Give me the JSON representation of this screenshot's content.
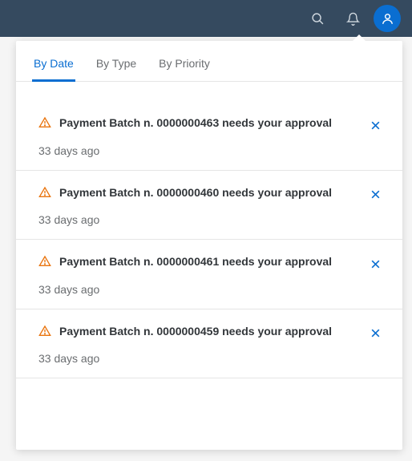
{
  "tabs": [
    {
      "label": "By Date",
      "active": true
    },
    {
      "label": "By Type",
      "active": false
    },
    {
      "label": "By Priority",
      "active": false
    }
  ],
  "notifications": [
    {
      "title": "Payment Batch n. 0000000463 needs your approval",
      "time": "33 days ago"
    },
    {
      "title": "Payment Batch n. 0000000460 needs your approval",
      "time": "33 days ago"
    },
    {
      "title": "Payment Batch n. 0000000461 needs your approval",
      "time": "33 days ago"
    },
    {
      "title": "Payment Batch n. 0000000459 needs your approval",
      "time": "33 days ago"
    }
  ]
}
